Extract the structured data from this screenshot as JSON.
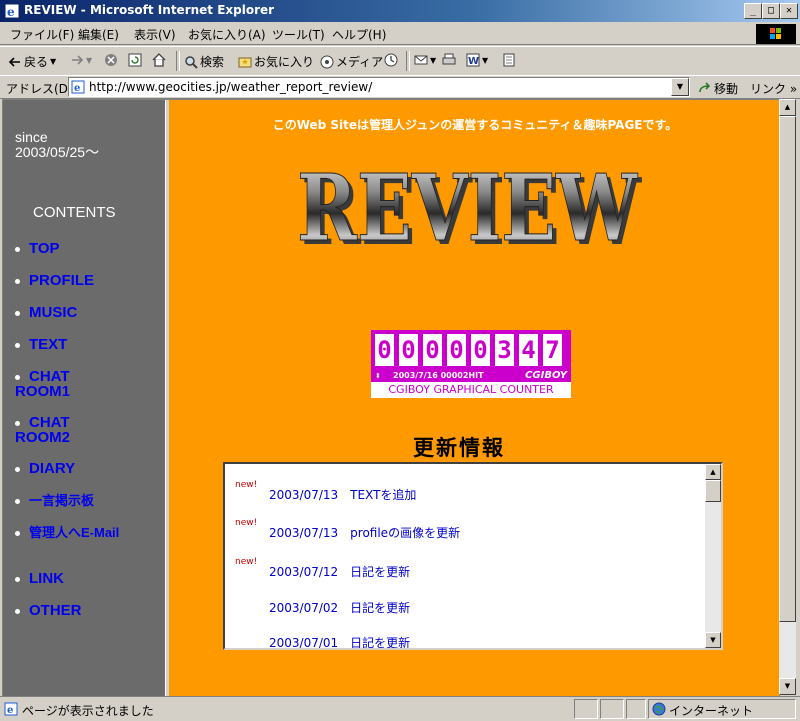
{
  "window": {
    "title": "REVIEW - Microsoft Internet Explorer",
    "min": "_",
    "max": "□",
    "close": "✕"
  },
  "menu": [
    "ファイル(F)",
    "編集(E)",
    "表示(V)",
    "お気に入り(A)",
    "ツール(T)",
    "ヘルプ(H)"
  ],
  "toolbar": {
    "back": "戻る",
    "search": "検索",
    "favorites": "お気に入り",
    "media": "メディア"
  },
  "address": {
    "label": "アドレス(D)",
    "url": "http://www.geocities.jp/weather_report_review/",
    "go": "移動",
    "links": "リンク »"
  },
  "page": {
    "tagline": "このWeb Siteは管理人ジュンの運営するコミュニティ＆趣味PAGEです。",
    "logo_text": "REVIEW",
    "sidebar": {
      "since_label": "since",
      "since_date": "2003/05/25～",
      "contents_label": "CONTENTS",
      "items": [
        "TOP",
        "PROFILE",
        "MUSIC",
        "TEXT",
        "CHAT",
        "ROOM1",
        "CHAT",
        "ROOM2",
        "DIARY",
        "一言掲示板",
        "管理人へE-Mail",
        "LINK",
        "OTHER"
      ]
    },
    "counter": {
      "digits": [
        "0",
        "0",
        "0",
        "0",
        "0",
        "3",
        "4",
        "7"
      ],
      "info": "2003/7/16 00002HIT",
      "brand": "CGIBOY",
      "label": "CGIBOY GRAPHICAL COUNTER"
    },
    "news_title": "更新情報",
    "news": [
      {
        "badge": "new!",
        "text": "2003/07/13　TEXTを追加"
      },
      {
        "badge": "new!",
        "text": "2003/07/13　profileの画像を更新"
      },
      {
        "badge": "new!",
        "text": "2003/07/12　日記を更新"
      },
      {
        "badge": "",
        "text": "2003/07/02　日記を更新"
      },
      {
        "badge": "",
        "text": "2003/07/01　日記を更新"
      }
    ]
  },
  "status": {
    "text": "ページが表示されました",
    "zone": "インターネット"
  },
  "colors": {
    "page_bg": "#ff9900",
    "sidebar_bg": "#6b6b6b",
    "link": "#0000ee",
    "counter": "#cc00cc"
  }
}
